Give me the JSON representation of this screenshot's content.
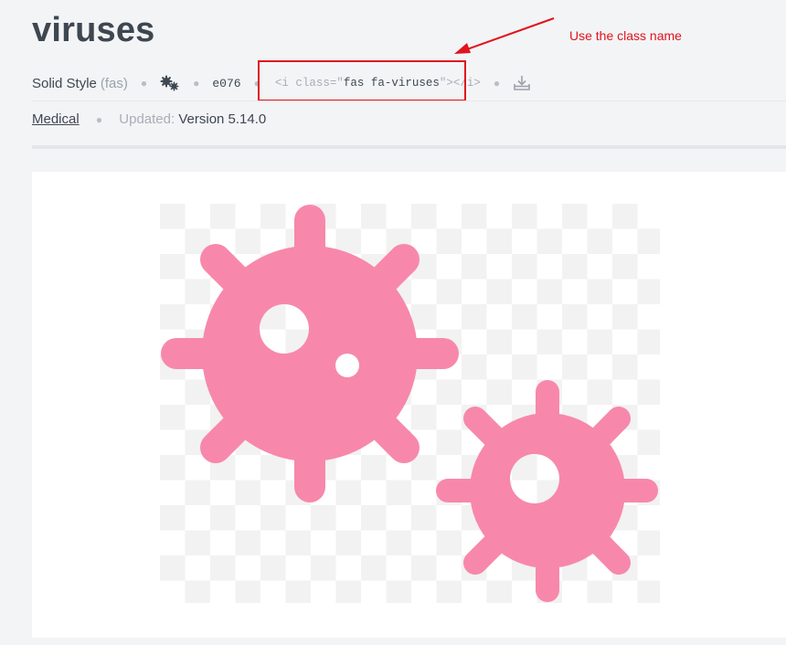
{
  "icon": {
    "title": "viruses",
    "style_name": "Solid Style",
    "style_prefix": "(fas)",
    "unicode": "e076",
    "code_open": "<i class=\"",
    "code_class": "fas fa-viruses",
    "code_close": "\"></i>",
    "icon_color": "#f788ab",
    "mini_icon": "viruses-icon",
    "download_icon": "download-icon"
  },
  "meta": {
    "category": "Medical",
    "updated_label": "Updated:",
    "version": "Version 5.14.0"
  },
  "annotation": {
    "text": "Use the class name",
    "color": "#e0141c"
  }
}
